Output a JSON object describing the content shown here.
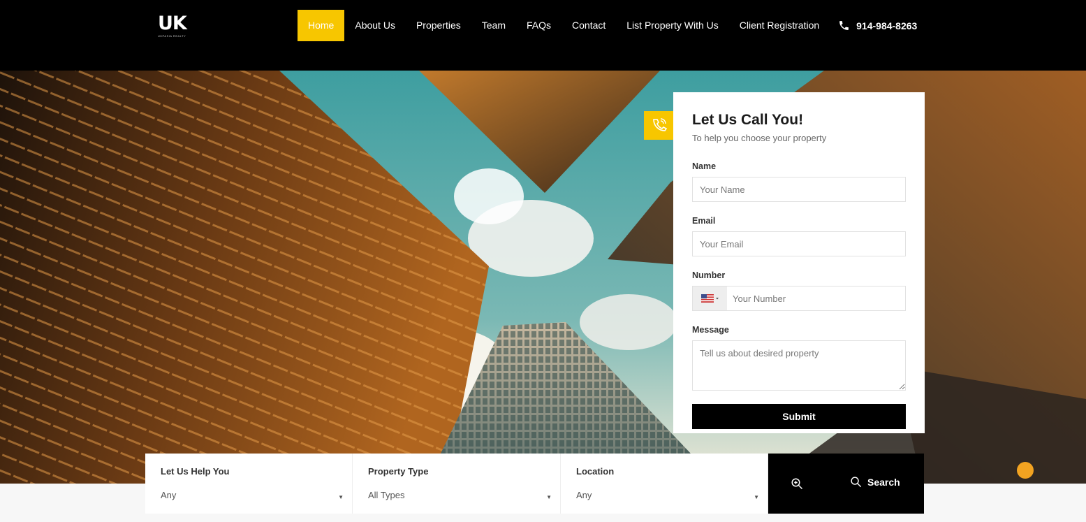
{
  "header": {
    "logo_mark": "UK",
    "logo_sub": "UKPASIA REALTY",
    "nav": [
      {
        "label": "Home",
        "active": true
      },
      {
        "label": "About Us"
      },
      {
        "label": "Properties"
      },
      {
        "label": "Team"
      },
      {
        "label": "FAQs"
      },
      {
        "label": "Contact"
      },
      {
        "label": "List Property With Us"
      },
      {
        "label": "Client Registration"
      }
    ],
    "phone": "914-984-8263",
    "phone_icon": "phone-icon"
  },
  "form": {
    "title": "Let Us Call You!",
    "subtitle": "To help you choose your property",
    "name_label": "Name",
    "name_placeholder": "Your Name",
    "email_label": "Email",
    "email_placeholder": "Your Email",
    "number_label": "Number",
    "number_placeholder": "Your Number",
    "country_flag": "us-flag-icon",
    "message_label": "Message",
    "message_placeholder": "Tell us about desired property",
    "submit_label": "Submit",
    "tag_icon": "phone-call-icon"
  },
  "search": {
    "fields": [
      {
        "label": "Let Us Help You",
        "value": "Any"
      },
      {
        "label": "Property Type",
        "value": "All Types"
      },
      {
        "label": "Location",
        "value": "Any"
      }
    ],
    "advanced_icon": "zoom-in-icon",
    "button_label": "Search",
    "button_icon": "search-icon"
  },
  "colors": {
    "accent": "#f7c600",
    "header_bg": "#000000",
    "button_bg": "#000000"
  }
}
